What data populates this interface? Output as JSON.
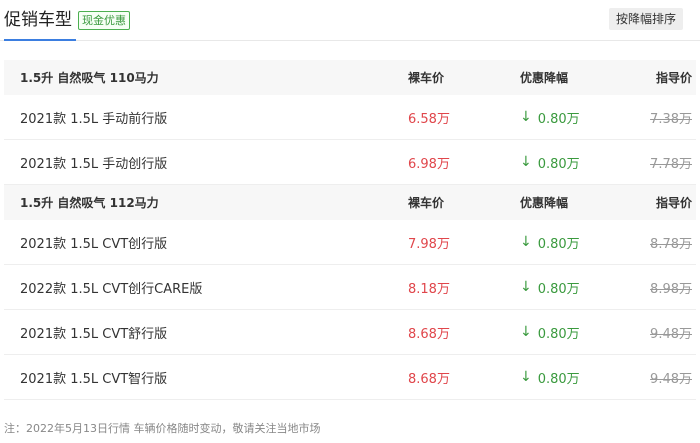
{
  "header": {
    "tab_title": "促销车型",
    "badge": "现金优惠",
    "sort_button": "按降幅排序"
  },
  "groups": [
    {
      "title": "1.5升 自然吸气 110马力",
      "col_price": "裸车价",
      "col_discount": "优惠降幅",
      "col_guide": "指导价",
      "rows": [
        {
          "name": "2021款 1.5L 手动前行版",
          "price": "6.58万",
          "discount": "0.80万",
          "guide": "7.38万"
        },
        {
          "name": "2021款 1.5L 手动创行版",
          "price": "6.98万",
          "discount": "0.80万",
          "guide": "7.78万"
        }
      ]
    },
    {
      "title": "1.5升 自然吸气 112马力",
      "col_price": "裸车价",
      "col_discount": "优惠降幅",
      "col_guide": "指导价",
      "rows": [
        {
          "name": "2021款 1.5L CVT创行版",
          "price": "7.98万",
          "discount": "0.80万",
          "guide": "8.78万"
        },
        {
          "name": "2022款 1.5L CVT创行CARE版",
          "price": "8.18万",
          "discount": "0.80万",
          "guide": "8.98万"
        },
        {
          "name": "2021款 1.5L CVT舒行版",
          "price": "8.68万",
          "discount": "0.80万",
          "guide": "9.48万"
        },
        {
          "name": "2021款 1.5L CVT智行版",
          "price": "8.68万",
          "discount": "0.80万",
          "guide": "9.48万"
        }
      ]
    }
  ],
  "icons": {
    "discount_arrow": "↓"
  },
  "colors": {
    "price": "#e0464b",
    "discount": "#3a9a3e",
    "accent": "#3b7ee0"
  },
  "footnote": "注：2022年5月13日行情 车辆价格随时变动，敬请关注当地市场"
}
